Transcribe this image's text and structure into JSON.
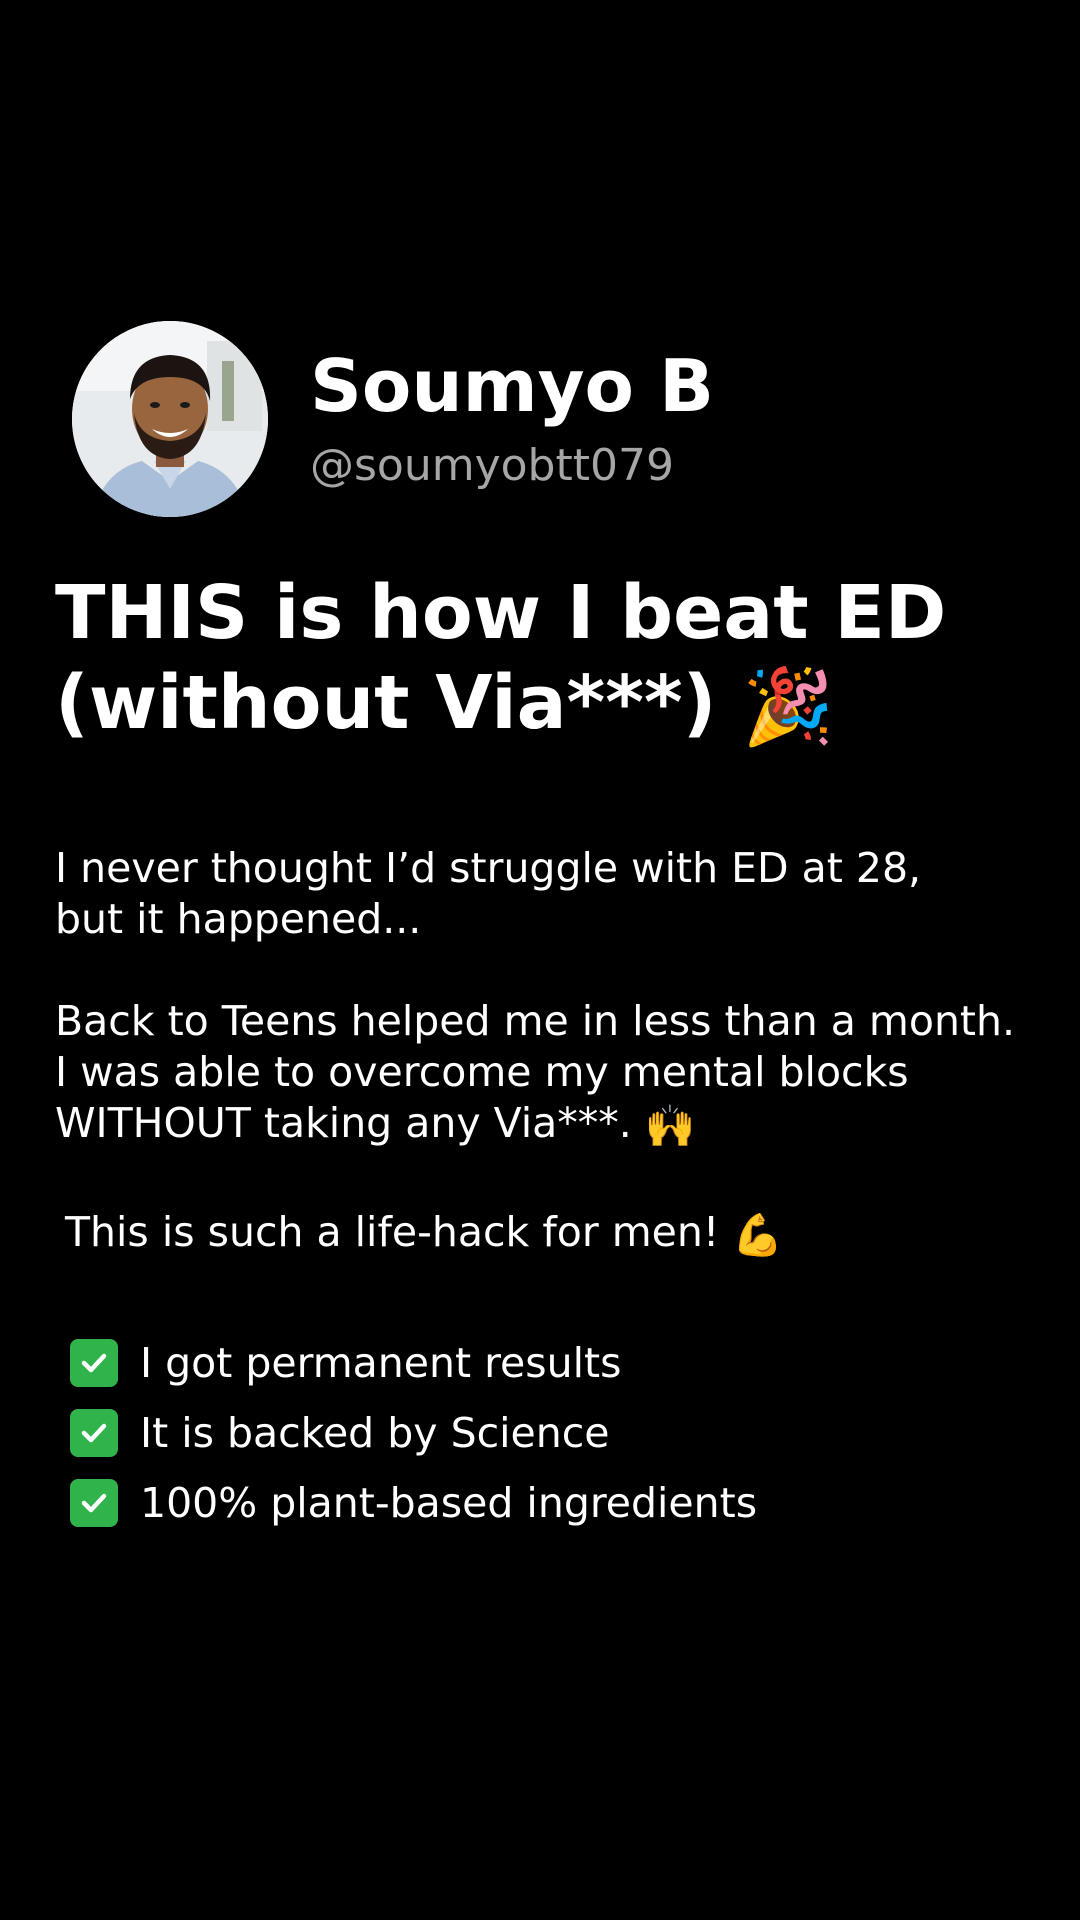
{
  "profile": {
    "name": "Soumyo B",
    "handle": "@soumyobtt079",
    "avatar_icon": "person-photo"
  },
  "headline": {
    "line1": "THIS is how I beat ED",
    "line2": "(without Via***)",
    "emoji": "🎉"
  },
  "body": {
    "p1_line1": "I never thought I’d struggle with ED at 28,",
    "p1_line2": "but it happened...",
    "p2_line1": "Back to Teens helped me in less than a month.",
    "p2_line2": "I was able to overcome my mental blocks",
    "p2_line3": "WITHOUT taking any Via***.",
    "p2_emoji": "🙌",
    "p3_text": "This is such a life-hack for men!",
    "p3_emoji": "💪"
  },
  "checklist": [
    {
      "icon": "check-mark-button",
      "text": "I got permanent results"
    },
    {
      "icon": "check-mark-button",
      "text": "It is backed by Science"
    },
    {
      "icon": "check-mark-button",
      "text": "100% plant-based ingredients"
    }
  ],
  "colors": {
    "background": "#000000",
    "text": "#ffffff",
    "handle": "#a6a6a6",
    "check": "#2fb34a"
  }
}
